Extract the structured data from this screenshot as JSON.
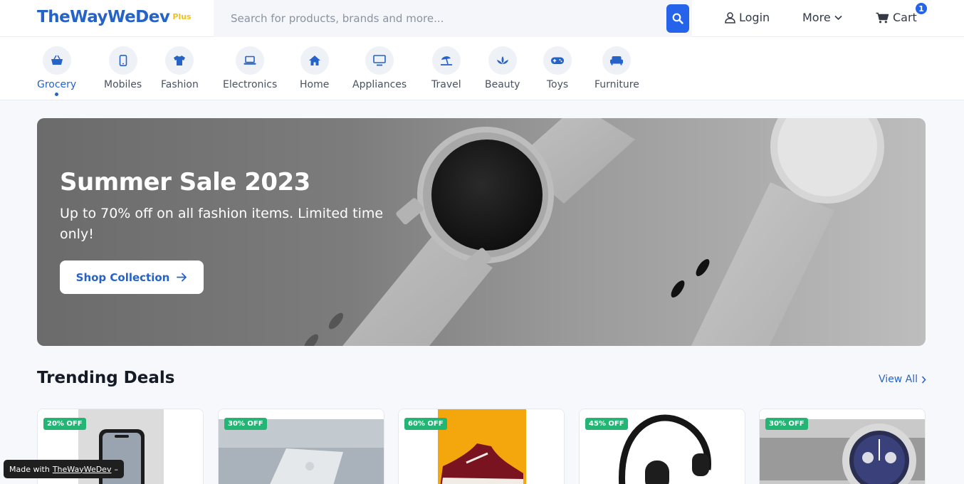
{
  "header": {
    "logo": "TheWayWeDev",
    "logo_badge": "Plus",
    "search_placeholder": "Search for products, brands and more...",
    "login_label": "Login",
    "more_label": "More",
    "cart_label": "Cart",
    "cart_count": "1"
  },
  "categories": [
    {
      "label": "Grocery",
      "icon": "basket-icon",
      "active": true
    },
    {
      "label": "Mobiles",
      "icon": "mobile-icon",
      "active": false
    },
    {
      "label": "Fashion",
      "icon": "tshirt-icon",
      "active": false
    },
    {
      "label": "Electronics",
      "icon": "laptop-icon",
      "active": false
    },
    {
      "label": "Home",
      "icon": "house-icon",
      "active": false
    },
    {
      "label": "Appliances",
      "icon": "monitor-icon",
      "active": false
    },
    {
      "label": "Travel",
      "icon": "umbrella-beach-icon",
      "active": false
    },
    {
      "label": "Beauty",
      "icon": "lotus-icon",
      "active": false
    },
    {
      "label": "Toys",
      "icon": "gamepad-icon",
      "active": false
    },
    {
      "label": "Furniture",
      "icon": "couch-icon",
      "active": false
    }
  ],
  "hero": {
    "title": "Summer Sale 2023",
    "subtitle": "Up to 70% off on all fashion items. Limited time only!",
    "button_label": "Shop Collection"
  },
  "trending": {
    "title": "Trending Deals",
    "view_all": "View All",
    "items": [
      {
        "discount": "20% OFF",
        "product": "smartphone"
      },
      {
        "discount": "30% OFF",
        "product": "laptop"
      },
      {
        "discount": "60% OFF",
        "product": "sneaker"
      },
      {
        "discount": "45% OFF",
        "product": "headphones"
      },
      {
        "discount": "30% OFF",
        "product": "wristwatch"
      }
    ]
  },
  "footer_badge": {
    "prefix": "Made with",
    "link": "TheWayWeDev",
    "suffix": "–"
  },
  "colors": {
    "brand": "#2563c9",
    "accent": "#2563eb",
    "plus": "#f2c316",
    "deal_badge": "#22b573"
  }
}
